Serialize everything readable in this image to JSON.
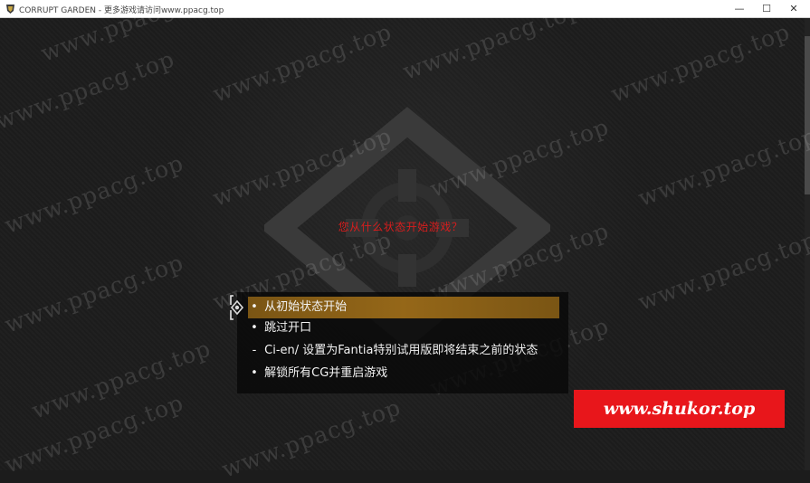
{
  "window": {
    "title": "CORRUPT GARDEN - 更多游戏请访问www.ppacg.top",
    "controls": {
      "minimize": "—",
      "maximize": "☐",
      "close": "✕"
    }
  },
  "game": {
    "prompt": "您从什么状态开始游戏？",
    "choices": [
      {
        "bullet": "•",
        "label": "从初始状态开始",
        "selected": true
      },
      {
        "bullet": "•",
        "label": "跳过开口",
        "selected": false
      },
      {
        "bullet": "-",
        "label": "Ci-en/ 设置为Fantia特别试用版即将结束之前的状态",
        "selected": false
      },
      {
        "bullet": "•",
        "label": "解锁所有CG并重启游戏",
        "selected": false
      }
    ],
    "selection_color": "#8a5f16",
    "prompt_color": "#d81d1d"
  },
  "watermark": {
    "text": "www.ppacg.top"
  },
  "badge": {
    "text": "www.shukor.top",
    "color": "#e8161b"
  }
}
